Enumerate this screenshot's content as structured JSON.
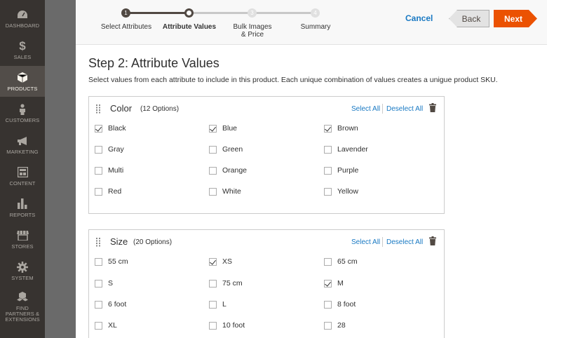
{
  "sidebar": {
    "items": [
      {
        "label": "DASHBOARD",
        "icon": "dashboard-icon",
        "active": false
      },
      {
        "label": "SALES",
        "icon": "dollar-icon",
        "active": false
      },
      {
        "label": "PRODUCTS",
        "icon": "cube-icon",
        "active": true
      },
      {
        "label": "CUSTOMERS",
        "icon": "person-icon",
        "active": false
      },
      {
        "label": "MARKETING",
        "icon": "megaphone-icon",
        "active": false
      },
      {
        "label": "CONTENT",
        "icon": "layout-icon",
        "active": false
      },
      {
        "label": "REPORTS",
        "icon": "bar-chart-icon",
        "active": false
      },
      {
        "label": "STORES",
        "icon": "store-icon",
        "active": false
      },
      {
        "label": "SYSTEM",
        "icon": "gear-icon",
        "active": false
      },
      {
        "label": "FIND PARTNERS & EXTENSIONS",
        "icon": "cubes-icon",
        "active": false
      }
    ]
  },
  "wizard": {
    "steps": [
      {
        "number": "1",
        "label": "Select Attributes",
        "state": "done"
      },
      {
        "number": "2",
        "label": "Attribute Values",
        "state": "current"
      },
      {
        "number": "3",
        "label": "Bulk Images & Price",
        "state": "todo"
      },
      {
        "number": "4",
        "label": "Summary",
        "state": "todo"
      }
    ],
    "cancel_label": "Cancel",
    "back_label": "Back",
    "next_label": "Next"
  },
  "page": {
    "title": "Step 2: Attribute Values",
    "description": "Select values from each attribute to include in this product. Each unique combination of values creates a unigue product SKU."
  },
  "attributes": [
    {
      "name": "Color",
      "count": "(12 Options)",
      "select_all": "Select All",
      "deselect_all": "Deselect All",
      "options": [
        {
          "label": "Black",
          "checked": true
        },
        {
          "label": "Blue",
          "checked": true
        },
        {
          "label": "Brown",
          "checked": true
        },
        {
          "label": "Gray",
          "checked": false
        },
        {
          "label": "Green",
          "checked": false
        },
        {
          "label": "Lavender",
          "checked": false
        },
        {
          "label": "Multi",
          "checked": false
        },
        {
          "label": "Orange",
          "checked": false
        },
        {
          "label": "Purple",
          "checked": false
        },
        {
          "label": "Red",
          "checked": false
        },
        {
          "label": "White",
          "checked": false
        },
        {
          "label": "Yellow",
          "checked": false
        }
      ]
    },
    {
      "name": "Size",
      "count": "(20 Options)",
      "select_all": "Select All",
      "deselect_all": "Deselect All",
      "options": [
        {
          "label": "55 cm",
          "checked": false
        },
        {
          "label": "XS",
          "checked": true
        },
        {
          "label": "65 cm",
          "checked": false
        },
        {
          "label": "S",
          "checked": false
        },
        {
          "label": "75 cm",
          "checked": false
        },
        {
          "label": "M",
          "checked": true
        },
        {
          "label": "6 foot",
          "checked": false
        },
        {
          "label": "L",
          "checked": false
        },
        {
          "label": "8 foot",
          "checked": false
        },
        {
          "label": "XL",
          "checked": false
        },
        {
          "label": "10 foot",
          "checked": false
        },
        {
          "label": "28",
          "checked": false
        }
      ]
    }
  ],
  "colors": {
    "sidebar_bg": "#373330",
    "accent": "#eb5202",
    "link": "#1979c3"
  }
}
